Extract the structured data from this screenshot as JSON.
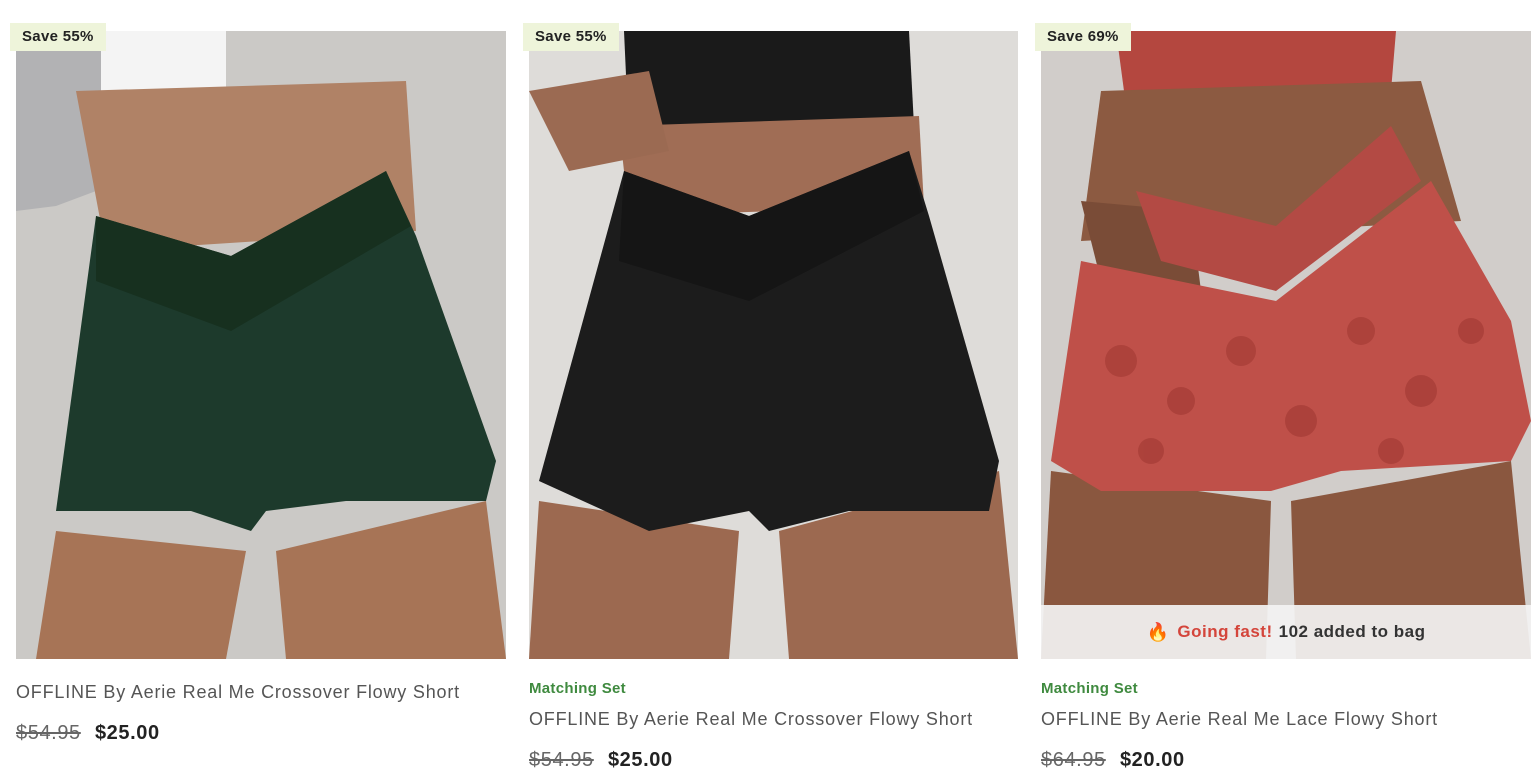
{
  "products": [
    {
      "badge": "Save 55%",
      "tag": "",
      "name": "OFFLINE By Aerie Real Me Crossover Flowy Short",
      "old_price": "$54.95",
      "new_price": "$25.00",
      "colors": {
        "short": "#1d3a2c",
        "bg": "#c9c7c4"
      }
    },
    {
      "badge": "Save 55%",
      "tag": "Matching Set",
      "name": "OFFLINE By Aerie Real Me Crossover Flowy Short",
      "old_price": "$54.95",
      "new_price": "$25.00",
      "colors": {
        "short": "#1c1c1c",
        "bg": "#dcdad7"
      }
    },
    {
      "badge": "Save 69%",
      "tag": "Matching Set",
      "name": "OFFLINE By Aerie Real Me Lace Flowy Short",
      "old_price": "$64.95",
      "new_price": "$20.00",
      "going_fast": {
        "icon": "fire-icon",
        "label": "Going fast!",
        "count_text": "102 added to bag"
      },
      "colors": {
        "short": "#b84a44",
        "bg": "#cfcbc8"
      }
    }
  ],
  "colors": {
    "tag_green": "#3f8a3f",
    "badge_bg": "#eef4da",
    "going_fast_red": "#d4453b"
  }
}
